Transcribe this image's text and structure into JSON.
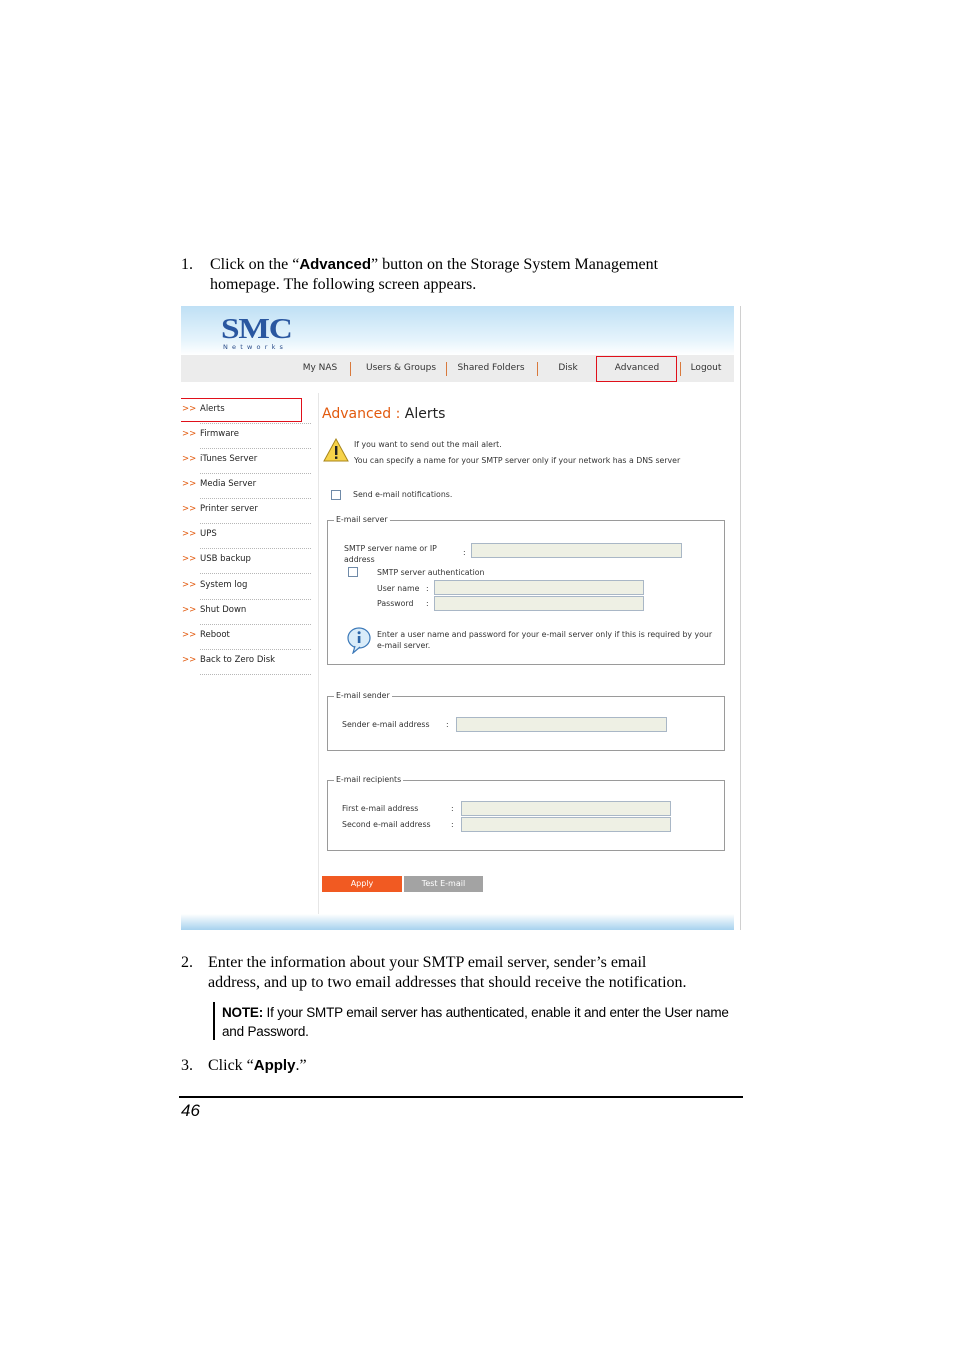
{
  "step1": {
    "number": "1.",
    "text_a": "Click on the “",
    "bold": "Advanced",
    "text_b": "” button on the Storage System Management",
    "line2": "homepage. The following screen appears."
  },
  "screenshot": {
    "logo": {
      "main": "SMC",
      "sub": "Networks"
    },
    "nav": [
      {
        "label": "My NAS"
      },
      {
        "label": "Users & Groups"
      },
      {
        "label": "Shared Folders"
      },
      {
        "label": "Disk"
      },
      {
        "label": "Advanced"
      },
      {
        "label": "Logout"
      }
    ],
    "sidebar_arrow": ">>",
    "sidebar": [
      {
        "label": "Alerts"
      },
      {
        "label": "Firmware"
      },
      {
        "label": "iTunes Server"
      },
      {
        "label": "Media Server"
      },
      {
        "label": "Printer server"
      },
      {
        "label": "UPS"
      },
      {
        "label": "USB backup"
      },
      {
        "label": "System log"
      },
      {
        "label": "Shut Down"
      },
      {
        "label": "Reboot"
      },
      {
        "label": "Back to Zero Disk"
      }
    ],
    "title_prefix": "Advanced :",
    "title_suffix": "Alerts",
    "warning_line1": "If you want to send out the mail alert.",
    "warning_line2": "You can specify a name for your SMTP server only if your network has a DNS server",
    "send_notifications": "Send e-mail notifications.",
    "email_server": {
      "legend": "E-mail server",
      "smtp_label_1": "SMTP server name or IP",
      "smtp_label_2": "address",
      "colon": ":",
      "auth_label": "SMTP server authentication",
      "username_label": "User name",
      "password_label": "Password",
      "info_line1": "Enter a user name and password for your e-mail server only if this is required by your",
      "info_line2": "e-mail server."
    },
    "email_sender": {
      "legend": "E-mail sender",
      "address_label": "Sender e-mail address"
    },
    "email_recipients": {
      "legend": "E-mail recipients",
      "first_label": "First e-mail address",
      "second_label": "Second e-mail address"
    },
    "apply_button": "Apply",
    "test_button": "Test E-mail"
  },
  "step2": {
    "number": "2.",
    "line1": "Enter the information about your SMTP email server, sender’s email",
    "line2": "address, and up to two email addresses that should receive the notification."
  },
  "note": {
    "label": "NOTE:",
    "line1": " If your SMTP email server has authenticated, enable it and enter the User name",
    "line2": "and Password."
  },
  "step3": {
    "number": "3.",
    "text_a": "Click “",
    "bold": "Apply",
    "text_b": ".”"
  },
  "page_number": "46",
  "colors": {
    "accent_orange": "#e25a0e",
    "highlight_red": "#e0101a",
    "header_blue": "#bfe0f5"
  }
}
